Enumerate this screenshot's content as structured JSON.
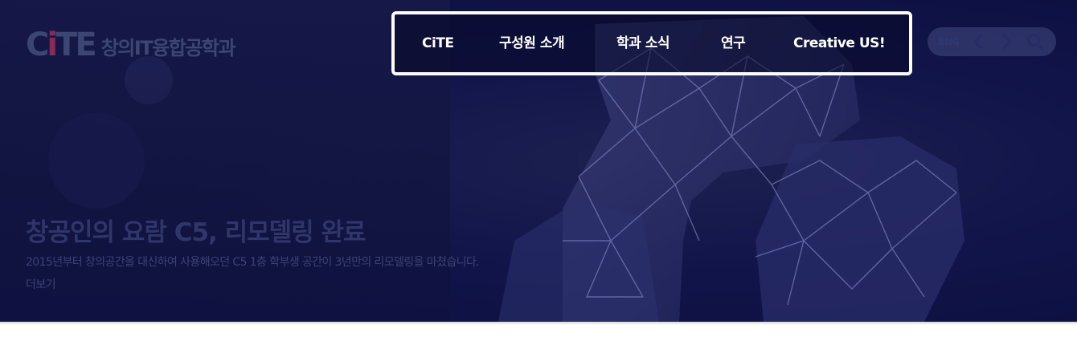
{
  "brand": {
    "logo_mark": "CiTE",
    "logo_text": "창의IT융합공학과"
  },
  "nav": {
    "items": [
      {
        "label": "CiTE"
      },
      {
        "label": "구성원 소개"
      },
      {
        "label": "학과 소식"
      },
      {
        "label": "연구"
      },
      {
        "label": "Creative US!"
      }
    ]
  },
  "utility": {
    "language": "ENG",
    "prev_icon": "chevron-left-icon",
    "next_icon": "chevron-right-icon",
    "search_icon": "search-icon"
  },
  "slide": {
    "title": "창공인의 요람 C5, 리모델링 완료",
    "description": "2015년부터 창의공간을 대신하여 사용해오던 C5 1층 학부생 공간이 3년만의 리모델링을 마쳤습니다.",
    "more": "더보기"
  },
  "colors": {
    "hero_background": "#12154a",
    "nav_border": "#ffffff",
    "logo_accent": "#8a2a58"
  }
}
